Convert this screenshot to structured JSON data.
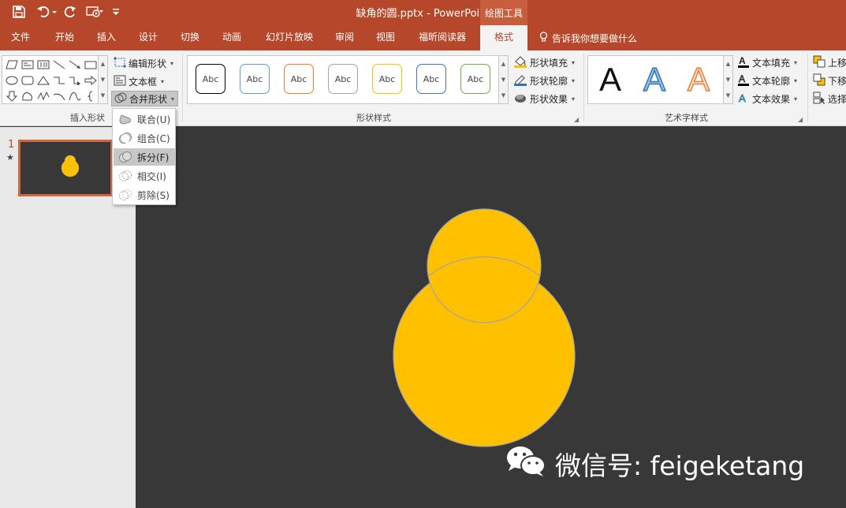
{
  "window": {
    "title": "缺角的圆.pptx - PowerPoint",
    "context_tab": "绘图工具"
  },
  "tabs": [
    {
      "label": "文件"
    },
    {
      "label": "开始"
    },
    {
      "label": "插入"
    },
    {
      "label": "设计"
    },
    {
      "label": "切换"
    },
    {
      "label": "动画"
    },
    {
      "label": "幻灯片放映"
    },
    {
      "label": "审阅"
    },
    {
      "label": "视图"
    },
    {
      "label": "福昕阅读器"
    },
    {
      "label": "格式"
    }
  ],
  "active_tab": "格式",
  "tell_me": "告诉我你想要做什么",
  "ribbon": {
    "insert_shapes": {
      "label": "插入形状",
      "edit_shape": "编辑形状",
      "text_box": "文本框",
      "merge_shapes": "合并形状"
    },
    "shape_styles": {
      "label": "形状样式",
      "sample_text": "Abc",
      "border_colors": [
        "#000000",
        "#5b9bd5",
        "#ed7d31",
        "#a5a5a5",
        "#ffc000",
        "#4472c4",
        "#70ad47"
      ],
      "fill": "形状填充",
      "outline": "形状轮廓",
      "effects": "形状效果"
    },
    "wordart": {
      "label": "艺术字样式",
      "sample": "A",
      "text_fill": "文本填充",
      "text_outline": "文本轮廓",
      "text_effects": "文本效果"
    },
    "arrange": {
      "bring_forward": "上移",
      "send_backward": "下移",
      "selection": "选择"
    }
  },
  "merge_menu": {
    "items": [
      {
        "label": "联合(U)"
      },
      {
        "label": "组合(C)"
      },
      {
        "label": "拆分(F)"
      },
      {
        "label": "相交(I)"
      },
      {
        "label": "剪除(S)"
      }
    ],
    "highlighted": "拆分(F)"
  },
  "slides_panel": {
    "slide_number": "1",
    "star": "★"
  },
  "canvas": {
    "shape_fill": "#ffc000",
    "shape_outline": "#a5a5a5",
    "background": "#383838"
  },
  "watermark": {
    "text": "微信号: feigeketang"
  },
  "colors": {
    "accent": "#b7472a",
    "ribbon_bg": "#f3f3f3"
  }
}
